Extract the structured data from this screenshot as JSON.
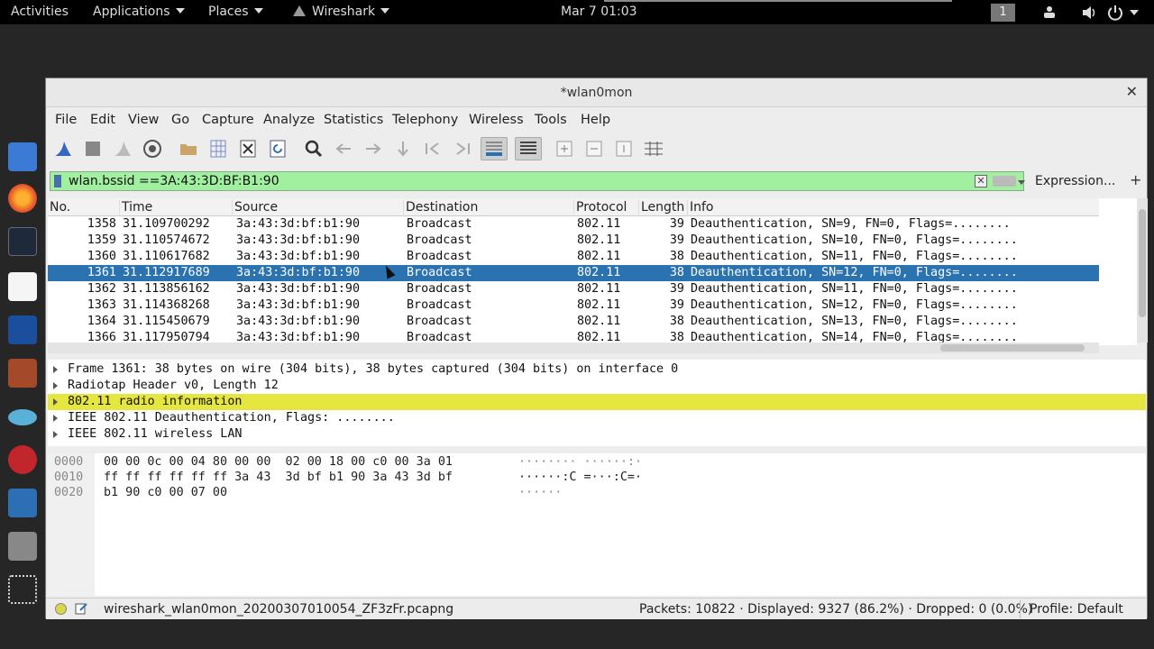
{
  "topbar": {
    "activities": "Activities",
    "applications": "Applications",
    "places": "Places",
    "app": "Wireshark",
    "clock": "Mar 7  01:03",
    "workspace": "1"
  },
  "window": {
    "title": "*wlan0mon",
    "close": "✕"
  },
  "menu": {
    "file": "File",
    "edit": "Edit",
    "view": "View",
    "go": "Go",
    "capture": "Capture",
    "analyze": "Analyze",
    "statistics": "Statistics",
    "telephony": "Telephony",
    "wireless": "Wireless",
    "tools": "Tools",
    "help": "Help"
  },
  "filter": {
    "value": "wlan.bssid ==3A:43:3D:BF:B1:90",
    "expression": "Expression...",
    "plus": "+"
  },
  "columns": {
    "no": "No.",
    "time": "Time",
    "source": "Source",
    "destination": "Destination",
    "protocol": "Protocol",
    "length": "Length",
    "info": "Info"
  },
  "packets": [
    {
      "no": "1358",
      "time": "31.109700292",
      "source": "3a:43:3d:bf:b1:90",
      "destination": "Broadcast",
      "protocol": "802.11",
      "length": "39",
      "info": "Deauthentication, SN=9, FN=0, Flags=........"
    },
    {
      "no": "1359",
      "time": "31.110574672",
      "source": "3a:43:3d:bf:b1:90",
      "destination": "Broadcast",
      "protocol": "802.11",
      "length": "39",
      "info": "Deauthentication, SN=10, FN=0, Flags=........"
    },
    {
      "no": "1360",
      "time": "31.110617682",
      "source": "3a:43:3d:bf:b1:90",
      "destination": "Broadcast",
      "protocol": "802.11",
      "length": "38",
      "info": "Deauthentication, SN=11, FN=0, Flags=........"
    },
    {
      "no": "1361",
      "time": "31.112917689",
      "source": "3a:43:3d:bf:b1:90",
      "destination": "Broadcast",
      "protocol": "802.11",
      "length": "38",
      "info": "Deauthentication, SN=12, FN=0, Flags=........"
    },
    {
      "no": "1362",
      "time": "31.113856162",
      "source": "3a:43:3d:bf:b1:90",
      "destination": "Broadcast",
      "protocol": "802.11",
      "length": "39",
      "info": "Deauthentication, SN=11, FN=0, Flags=........"
    },
    {
      "no": "1363",
      "time": "31.114368268",
      "source": "3a:43:3d:bf:b1:90",
      "destination": "Broadcast",
      "protocol": "802.11",
      "length": "39",
      "info": "Deauthentication, SN=12, FN=0, Flags=........"
    },
    {
      "no": "1364",
      "time": "31.115450679",
      "source": "3a:43:3d:bf:b1:90",
      "destination": "Broadcast",
      "protocol": "802.11",
      "length": "38",
      "info": "Deauthentication, SN=13, FN=0, Flags=........"
    },
    {
      "no": "1366",
      "time": "31.117950794",
      "source": "3a:43:3d:bf:b1:90",
      "destination": "Broadcast",
      "protocol": "802.11",
      "length": "38",
      "info": "Deauthentication, SN=14, FN=0, Flags=........"
    }
  ],
  "details": [
    "Frame 1361: 38 bytes on wire (304 bits), 38 bytes captured (304 bits) on interface 0",
    "Radiotap Header v0, Length 12",
    "802.11 radio information",
    "IEEE 802.11 Deauthentication, Flags: ........",
    "IEEE 802.11 wireless LAN"
  ],
  "bytes": [
    {
      "offset": "0000",
      "hex": "00 00 0c 00 04 80 00 00  02 00 18 00 c0 00 3a 01",
      "ascii": "········ ······:·"
    },
    {
      "offset": "0010",
      "hex": "ff ff ff ff ff ff 3a 43  3d bf b1 90 3a 43 3d bf",
      "ascii": "······:C =···:C=·"
    },
    {
      "offset": "0020",
      "hex": "b1 90 c0 00 07 00",
      "ascii": "······"
    }
  ],
  "status": {
    "file": "wireshark_wlan0mon_20200307010054_ZF3zFr.pcapng",
    "packets": "Packets: 10822 · Displayed: 9327 (86.2%) · Dropped: 0 (0.0%)",
    "profile": "Profile: Default"
  },
  "colors": {
    "selected_row": "#2a72b0",
    "filter_valid": "#a0f0a0",
    "highlight": "#e6e640"
  }
}
